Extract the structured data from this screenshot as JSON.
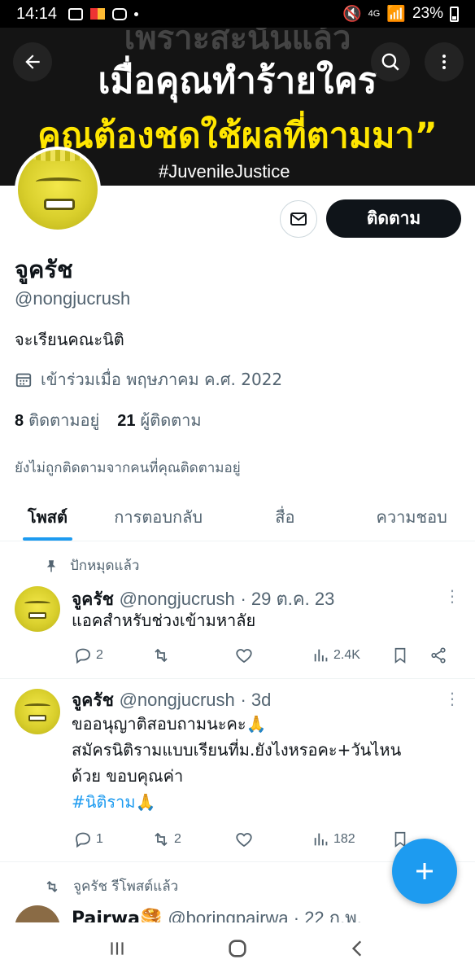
{
  "status_bar": {
    "time": "14:14",
    "battery": "23%",
    "network": "4G"
  },
  "banner": {
    "top_partial": "เพราะสะนั้นแล้ว",
    "line1": "เมื่อคุณทำร้ายใคร",
    "line2": "คุณต้องชดใช้ผลที่ตามมา”",
    "hashtag": "#JuvenileJustice"
  },
  "profile": {
    "follow_label": "ติดตาม",
    "name": "จูครัช",
    "handle": "@nongjucrush",
    "bio": "จะเรียนคณะนิติ",
    "joined": "เข้าร่วมเมื่อ พฤษภาคม ค.ศ. 2022",
    "following_count": "8",
    "following_label": "ติดตามอยู่",
    "followers_count": "21",
    "followers_label": "ผู้ติดตาม",
    "not_followed_note": "ยังไม่ถูกติดตามจากคนที่คุณติดตามอยู่"
  },
  "tabs": [
    {
      "label": "โพสต์"
    },
    {
      "label": "การตอบกลับ"
    },
    {
      "label": "สื่อ"
    },
    {
      "label": "ความชอบ"
    }
  ],
  "tweets": [
    {
      "pinned_label": "ปักหมุดแล้ว",
      "name": "จูครัช",
      "handle": "@nongjucrush",
      "time": "· 29 ต.ค. 23",
      "text": "แอคสำหรับช่วงเข้ามหาลัย",
      "replies": "2",
      "reposts": "",
      "views": "2.4K"
    },
    {
      "name": "จูครัช",
      "handle": "@nongjucrush",
      "time": "· 3d",
      "line1": "ขออนุญาติสอบถามนะคะ🙏",
      "line2": "สมัครนิติรามแบบเรียนที่ม.ยังไงหรอคะ+วันไหน",
      "line3": "ด้วย ขอบคุณค่า",
      "hashtag": "#นิติราม🙏",
      "replies": "1",
      "reposts": "2",
      "views": "182"
    }
  ],
  "repost": {
    "label": "จูครัช รีโพสต์แล้ว",
    "name": "Pairwa🥞",
    "handle": "@boringpairwa · 22 ก.พ."
  }
}
